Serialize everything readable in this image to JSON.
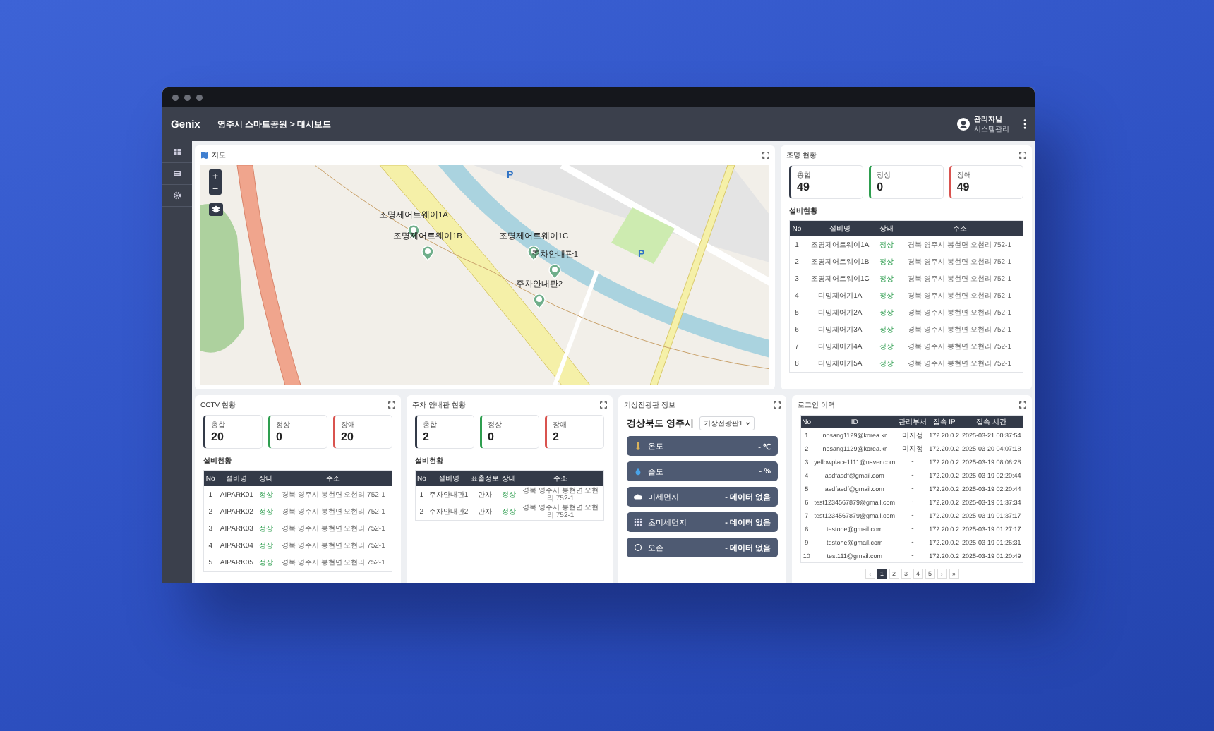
{
  "header": {
    "logo": "Genix",
    "breadcrumb": "영주시 스마트공원 > 대시보드",
    "user_name": "관리자님",
    "user_role": "시스템관리"
  },
  "map": {
    "title": "지도",
    "zoom_in": "+",
    "zoom_out": "−",
    "parking_signs": [
      "P",
      "P"
    ],
    "markers": [
      {
        "label": "조명제어트웨이1A"
      },
      {
        "label": "조명제어트웨이1B"
      },
      {
        "label": "조명제어트웨이1C"
      },
      {
        "label": "주차안내판1"
      },
      {
        "label": "주차안내판2"
      }
    ]
  },
  "status_panels": [
    {
      "title": "조명 현황",
      "stats": [
        {
          "label": "총합",
          "value": "49",
          "color": "#333a48"
        },
        {
          "label": "정상",
          "value": "0",
          "color": "#2e9e4f"
        },
        {
          "label": "장애",
          "value": "49",
          "color": "#d9534f"
        }
      ],
      "table_title": "설비현황",
      "columns": [
        {
          "label": "No",
          "kind": "num"
        },
        {
          "label": "설비명",
          "kind": "text"
        },
        {
          "label": "상태",
          "kind": "status"
        },
        {
          "label": "주소",
          "kind": "address"
        }
      ],
      "rows": [
        [
          "1",
          "조명제어트웨이1A",
          "정상",
          "경북 영주시 봉현면 오현리 752-1"
        ],
        [
          "2",
          "조명제어트웨이1B",
          "정상",
          "경북 영주시 봉현면 오현리 752-1"
        ],
        [
          "3",
          "조명제어트웨이1C",
          "정상",
          "경북 영주시 봉현면 오현리 752-1"
        ],
        [
          "4",
          "디밍제어기1A",
          "정상",
          "경북 영주시 봉현면 오현리 752-1"
        ],
        [
          "5",
          "디밍제어기2A",
          "정상",
          "경북 영주시 봉현면 오현리 752-1"
        ],
        [
          "6",
          "디밍제어기3A",
          "정상",
          "경북 영주시 봉현면 오현리 752-1"
        ],
        [
          "7",
          "디밍제어기4A",
          "정상",
          "경북 영주시 봉현면 오현리 752-1"
        ],
        [
          "8",
          "디밍제어기5A",
          "정상",
          "경북 영주시 봉현면 오현리 752-1"
        ]
      ]
    },
    {
      "title": "CCTV 현황",
      "stats": [
        {
          "label": "총합",
          "value": "20",
          "color": "#333a48"
        },
        {
          "label": "정상",
          "value": "0",
          "color": "#2e9e4f"
        },
        {
          "label": "장애",
          "value": "20",
          "color": "#d9534f"
        }
      ],
      "table_title": "설비현황",
      "columns": [
        {
          "label": "No",
          "kind": "num"
        },
        {
          "label": "설비명",
          "kind": "text"
        },
        {
          "label": "상태",
          "kind": "status"
        },
        {
          "label": "주소",
          "kind": "address"
        }
      ],
      "rows": [
        [
          "1",
          "AIPARK01",
          "정상",
          "경북 영주시 봉현면 오현리 752-1"
        ],
        [
          "2",
          "AIPARK02",
          "정상",
          "경북 영주시 봉현면 오현리 752-1"
        ],
        [
          "3",
          "AIPARK03",
          "정상",
          "경북 영주시 봉현면 오현리 752-1"
        ],
        [
          "4",
          "AIPARK04",
          "정상",
          "경북 영주시 봉현면 오현리 752-1"
        ],
        [
          "5",
          "AIPARK05",
          "정상",
          "경북 영주시 봉현면 오현리 752-1"
        ]
      ]
    },
    {
      "title": "주차 안내판 현황",
      "stats": [
        {
          "label": "총합",
          "value": "2",
          "color": "#333a48"
        },
        {
          "label": "정상",
          "value": "0",
          "color": "#2e9e4f"
        },
        {
          "label": "장애",
          "value": "2",
          "color": "#d9534f"
        }
      ],
      "table_title": "설비현황",
      "columns": [
        {
          "label": "No",
          "kind": "num"
        },
        {
          "label": "설비명",
          "kind": "text"
        },
        {
          "label": "표출정보",
          "kind": "text"
        },
        {
          "label": "상태",
          "kind": "status"
        },
        {
          "label": "주소",
          "kind": "address"
        }
      ],
      "rows": [
        [
          "1",
          "주차안내판1",
          "만차",
          "정상",
          "경북 영주시 봉현면 오현리 752-1"
        ],
        [
          "2",
          "주차안내판2",
          "만차",
          "정상",
          "경북 영주시 봉현면 오현리 752-1"
        ]
      ]
    }
  ],
  "weather": {
    "title": "기상전광판 정보",
    "location": "경상북도 영주시",
    "station": "기상전광판1",
    "items": [
      {
        "kind": "thermometer",
        "label": "온도",
        "value": "- ℃"
      },
      {
        "kind": "droplet",
        "label": "습도",
        "value": "- %"
      },
      {
        "kind": "cloud",
        "label": "미세먼지",
        "value": "- 데이터 없음"
      },
      {
        "kind": "dots",
        "label": "초미세먼지",
        "value": "- 데이터 없음"
      },
      {
        "kind": "ring",
        "label": "오존",
        "value": "- 데이터 없음"
      }
    ]
  },
  "login_history": {
    "title": "로그인 이력",
    "columns": [
      "No",
      "ID",
      "관리부서",
      "접속 IP",
      "접속 시간"
    ],
    "rows": [
      [
        "1",
        "nosang1129@korea.kr",
        "미지정",
        "172.20.0.2",
        "2025-03-21 00:37:54"
      ],
      [
        "2",
        "nosang1129@korea.kr",
        "미지정",
        "172.20.0.2",
        "2025-03-20 04:07:18"
      ],
      [
        "3",
        "yellowplace1111@naver.com",
        "-",
        "172.20.0.2",
        "2025-03-19 08:08:28"
      ],
      [
        "4",
        "asdfasdf@gmail.com",
        "-",
        "172.20.0.2",
        "2025-03-19 02:20:44"
      ],
      [
        "5",
        "asdfasdf@gmail.com",
        "-",
        "172.20.0.2",
        "2025-03-19 02:20:44"
      ],
      [
        "6",
        "test1234567879@gmail.com",
        "-",
        "172.20.0.2",
        "2025-03-19 01:37:34"
      ],
      [
        "7",
        "test1234567879@gmail.com",
        "-",
        "172.20.0.2",
        "2025-03-19 01:37:17"
      ],
      [
        "8",
        "testone@gmail.com",
        "-",
        "172.20.0.2",
        "2025-03-19 01:27:17"
      ],
      [
        "9",
        "testone@gmail.com",
        "-",
        "172.20.0.2",
        "2025-03-19 01:26:31"
      ],
      [
        "10",
        "test111@gmail.com",
        "-",
        "172.20.0.2",
        "2025-03-19 01:20:49"
      ]
    ],
    "pages": [
      {
        "label": "‹",
        "selected": false
      },
      {
        "label": "1",
        "selected": true
      },
      {
        "label": "2",
        "selected": false
      },
      {
        "label": "3",
        "selected": false
      },
      {
        "label": "4",
        "selected": false
      },
      {
        "label": "5",
        "selected": false
      },
      {
        "label": "›",
        "selected": false
      },
      {
        "label": "»",
        "selected": false
      }
    ]
  }
}
